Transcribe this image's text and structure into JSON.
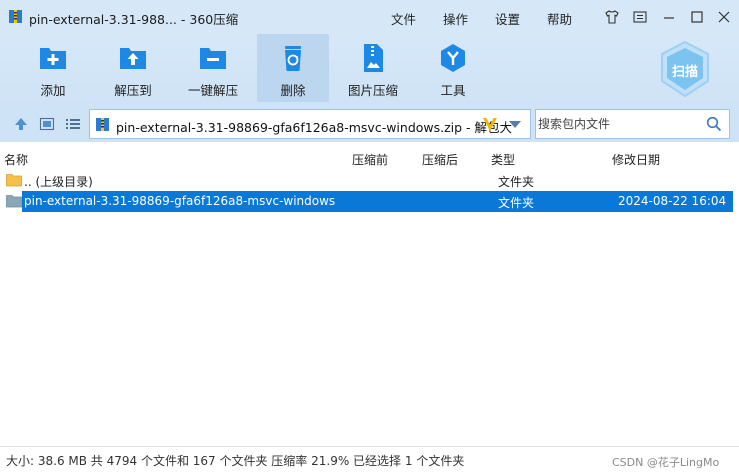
{
  "window": {
    "title": "pin-external-3.31-988... - 360压缩",
    "menu": [
      "文件",
      "操作",
      "设置",
      "帮助"
    ]
  },
  "toolbar": {
    "buttons": [
      {
        "label": "添加",
        "icon": "add-icon"
      },
      {
        "label": "解压到",
        "icon": "extract-to-icon"
      },
      {
        "label": "一键解压",
        "icon": "one-click-extract-icon"
      },
      {
        "label": "删除",
        "icon": "recycle-delete-icon"
      },
      {
        "label": "图片压缩",
        "icon": "image-compress-icon"
      },
      {
        "label": "工具",
        "icon": "tools-icon"
      }
    ],
    "scan_label": "扫描"
  },
  "address": {
    "path": "pin-external-3.31-98869-gfa6f126a8-msvc-windows.zip - 解包大"
  },
  "search": {
    "placeholder": "搜索包内文件"
  },
  "list": {
    "columns": [
      "名称",
      "压缩前",
      "压缩后",
      "类型",
      "修改日期"
    ],
    "rows": [
      {
        "name": ".. (上级目录)",
        "type": "文件夹",
        "date": ""
      },
      {
        "name": "pin-external-3.31-98869-gfa6f126a8-msvc-windows",
        "type": "文件夹",
        "date": "2024-08-22 16:04"
      }
    ]
  },
  "status": {
    "text": "大小: 38.6 MB 共 4794 个文件和 167 个文件夹 压缩率 21.9% 已经选择 1 个文件夹"
  },
  "watermark": "CSDN @花子LingMo",
  "colors": {
    "titlebar": "#d6e8f8",
    "selection": "#0a78d7",
    "icon_blue": "#1e88e5"
  }
}
